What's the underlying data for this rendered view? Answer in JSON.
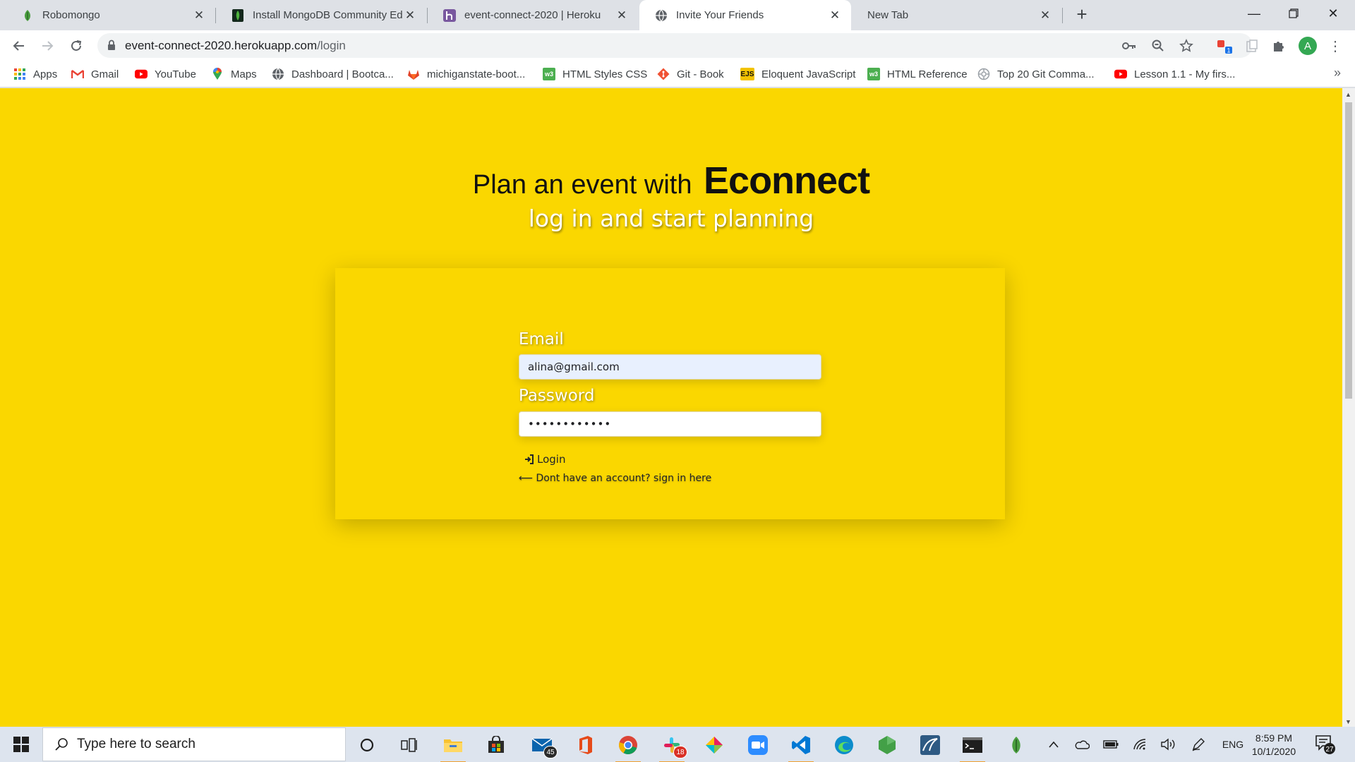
{
  "browser": {
    "tabs": [
      {
        "title": "Robomongo",
        "icon": "robomongo-icon"
      },
      {
        "title": "Install MongoDB Community Edi",
        "icon": "mongodb-icon"
      },
      {
        "title": "event-connect-2020 | Heroku",
        "icon": "heroku-icon"
      },
      {
        "title": "Invite Your Friends",
        "icon": "globe-icon"
      },
      {
        "title": "New Tab",
        "icon": ""
      }
    ],
    "active_tab": "Invite Your Friends",
    "url_host": "event-connect-2020.herokuapp.com",
    "url_path": "/login",
    "profile_initial": "A",
    "extension_badge": "1"
  },
  "bookmarks": [
    {
      "label": "Apps",
      "icon": "apps-grid-icon"
    },
    {
      "label": "Gmail",
      "icon": "gmail-icon"
    },
    {
      "label": "YouTube",
      "icon": "youtube-icon"
    },
    {
      "label": "Maps",
      "icon": "maps-icon"
    },
    {
      "label": "Dashboard | Bootca...",
      "icon": "globe-icon"
    },
    {
      "label": "michiganstate-boot...",
      "icon": "gitlab-icon"
    },
    {
      "label": "HTML Styles CSS",
      "icon": "w3schools-icon"
    },
    {
      "label": "Git - Book",
      "icon": "git-icon"
    },
    {
      "label": "Eloquent JavaScript",
      "icon": "ejs-icon"
    },
    {
      "label": "HTML Reference",
      "icon": "w3schools-icon"
    },
    {
      "label": "Top 20 Git Comma...",
      "icon": "settings-globe-icon"
    },
    {
      "label": "Lesson 1.1 - My firs...",
      "icon": "youtube-icon"
    }
  ],
  "page": {
    "headline_prefix": "Plan an event with",
    "brand": "Econnect",
    "subtitle": "log in and start planning",
    "form": {
      "email_label": "Email",
      "email_value": "alina@gmail.com",
      "password_label": "Password",
      "password_value": "••••••••••••",
      "login_label": "Login",
      "signup_text": "⟵ Dont have an account? sign in here"
    },
    "background_color": "#fad700"
  },
  "taskbar": {
    "search_placeholder": "Type here to search",
    "mail_badge": "45",
    "slack_badge": "18",
    "language": "ENG",
    "time": "8:59 PM",
    "date": "10/1/2020",
    "notification_count": "27"
  }
}
